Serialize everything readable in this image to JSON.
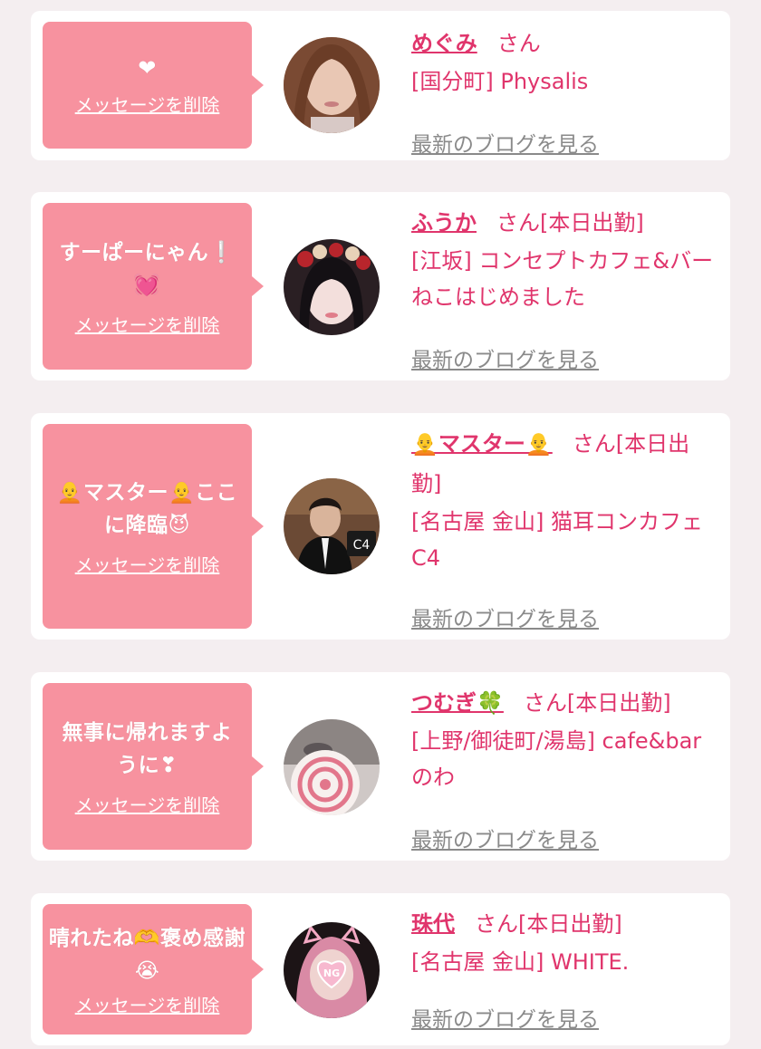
{
  "colors": {
    "bubble": "#f7929f",
    "accent": "#e0356c",
    "blog_link": "#8a8a8a",
    "card": "#ffffff",
    "page_bg": "#f4eef0"
  },
  "cards": [
    {
      "message": "❤",
      "delete_label": "メッセージを削除",
      "name": "めぐみ",
      "san": "さん",
      "status": "",
      "shop": "[国分町] Physalis",
      "blog_label": "最新のブログを見る",
      "avatar": "avatar-photo"
    },
    {
      "message": "すーぱーにゃん❕💓",
      "delete_label": "メッセージを削除",
      "name": "ふうか",
      "san": "さん",
      "status": "[本日出勤]",
      "shop": "[江坂] コンセプトカフェ&バー　ねこはじめました",
      "blog_label": "最新のブログを見る",
      "avatar": "avatar-photo"
    },
    {
      "message": "🧑‍🦲マスター🧑‍🦲ここに降臨😈",
      "delete_label": "メッセージを削除",
      "name": "🧑‍🦲マスター🧑‍🦲",
      "san": "さん",
      "status": "[本日出勤]",
      "shop": "[名古屋 金山] 猫耳コンカフェ C4",
      "blog_label": "最新のブログを見る",
      "avatar": "avatar-photo"
    },
    {
      "message": "無事に帰れますように❣",
      "delete_label": "メッセージを削除",
      "name": "つむぎ🍀",
      "san": "さん",
      "status": "[本日出勤]",
      "shop": "[上野/御徒町/湯島] cafe&bar のわ",
      "blog_label": "最新のブログを見る",
      "avatar": "avatar-photo"
    },
    {
      "message": "晴れたね🫶褒め感謝😭",
      "delete_label": "メッセージを削除",
      "name": "珠代",
      "san": "さん",
      "status": "[本日出勤]",
      "shop": "[名古屋 金山] WHITE.",
      "blog_label": "最新のブログを見る",
      "avatar": "avatar-photo"
    }
  ]
}
